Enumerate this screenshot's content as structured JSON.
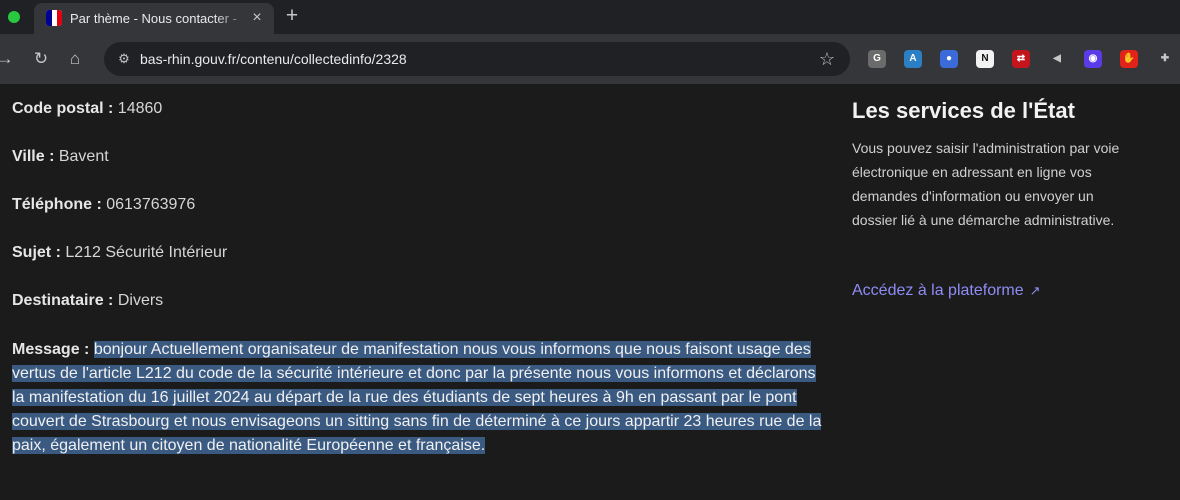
{
  "browser": {
    "tab": {
      "title": "Par thème - Nous contacter -",
      "close_glyph": "×"
    },
    "new_tab_glyph": "+",
    "nav": {
      "back_glyph": "→",
      "reload_glyph": "↻",
      "home_glyph": "⌂"
    },
    "address_bar": {
      "url": "bas-rhin.gouv.fr/contenu/collectedinfo/2328",
      "site_info_glyph": "⚙"
    },
    "bookmark_glyph": "☆",
    "extensions": [
      {
        "name": "g-extension-icon",
        "glyph": "G",
        "color": "#6b6b6b"
      },
      {
        "name": "translate-extension-icon",
        "glyph": "A",
        "color": "#2b7fc5"
      },
      {
        "name": "colorful-extension-icon",
        "glyph": "●",
        "color": "#3b6bd9"
      },
      {
        "name": "notion-extension-icon",
        "glyph": "N",
        "color": "#f2f2f2"
      },
      {
        "name": "red-arrow-extension-icon",
        "glyph": "⇄",
        "color": "#c4141c"
      },
      {
        "name": "speaker-extension-icon",
        "glyph": "◀",
        "color": "#35363a"
      },
      {
        "name": "face-extension-icon",
        "glyph": "◉",
        "color": "#5b3be8"
      },
      {
        "name": "hand-extension-icon",
        "glyph": "✋",
        "color": "#e1231a"
      },
      {
        "name": "puzzle-extension-icon",
        "glyph": "✚",
        "color": "#35363a"
      }
    ]
  },
  "fields": {
    "code_postal": {
      "label": "Code postal :",
      "value": "14860"
    },
    "ville": {
      "label": "Ville :",
      "value": "Bavent"
    },
    "telephone": {
      "label": "Téléphone :",
      "value": "0613763976"
    },
    "sujet": {
      "label": "Sujet :",
      "value": "L212 Sécurité Intérieur"
    },
    "destinataire": {
      "label": "Destinataire :",
      "value": "Divers"
    }
  },
  "message": {
    "label": "Message :",
    "text": "bonjour Actuellement organisateur de manifestation nous vous informons que nous faisont usage des vertus de l'article L212 du code de la sécurité intérieure et donc par la présente nous vous informons et déclarons la manifestation du 16 juillet 2024 au départ de la rue des étudiants de sept heures à 9h en passant par le pont couvert de Strasbourg et nous envisageons un sitting sans fin de déterminé à ce jours appartir 23 heures rue de la paix, également un citoyen de nationalité Européenne et française."
  },
  "sidebar": {
    "title": "Les services de l'État",
    "text": "Vous pouvez saisir l'administration par voie électronique en adressant en ligne vos demandes d'information ou envoyer un dossier lié à une démarche administrative.",
    "link": "Accédez à la plateforme",
    "link_icon_glyph": "↗"
  },
  "colors": {
    "background": "#1b1b1b",
    "selection": "#3a5a82",
    "link": "#8f8cf6"
  }
}
